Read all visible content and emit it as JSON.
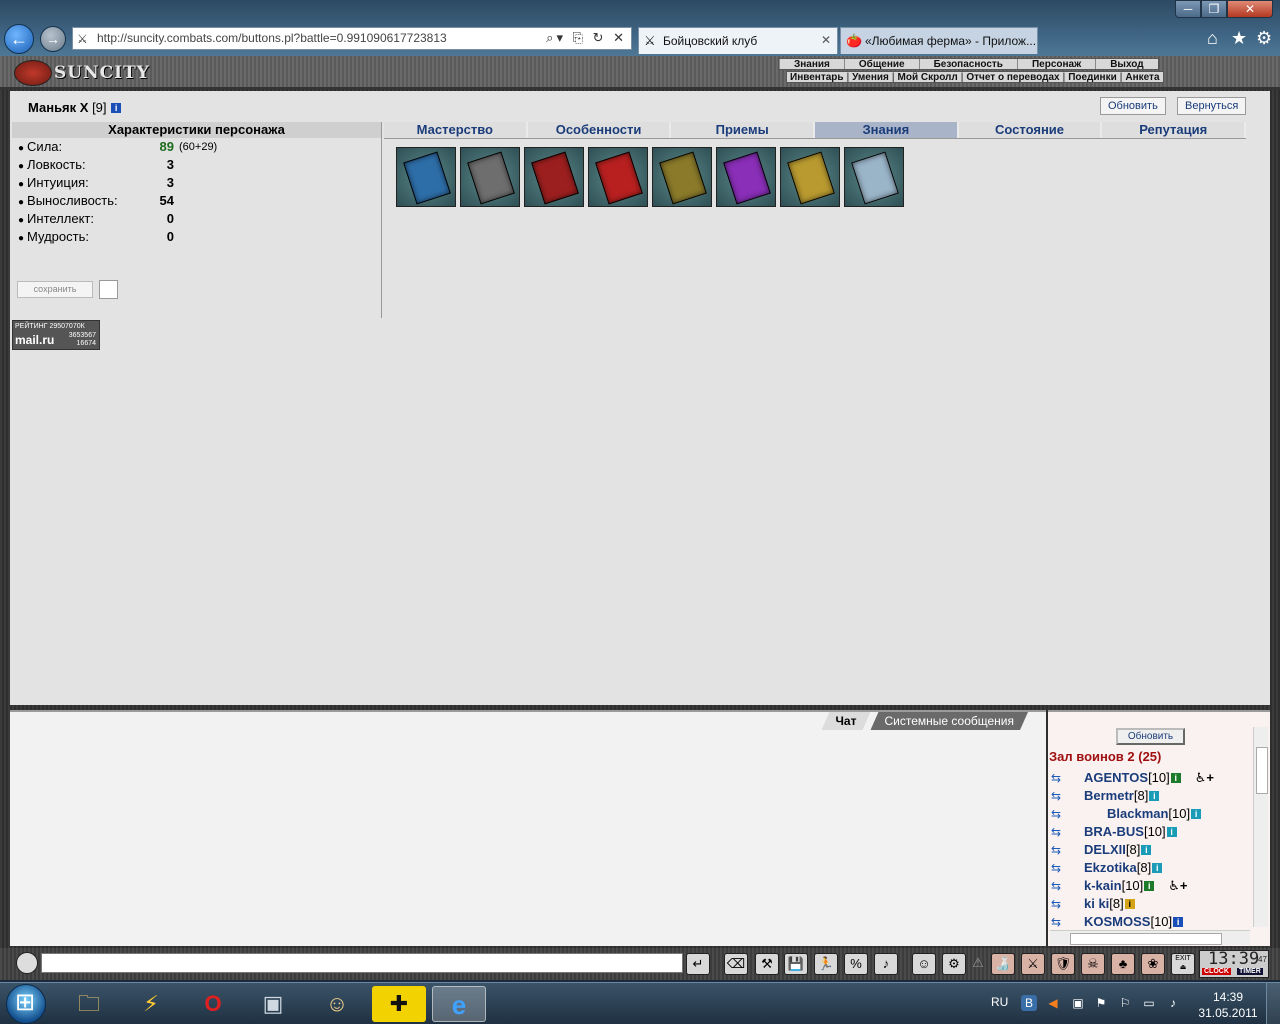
{
  "browser": {
    "url": "http://suncity.combats.com/buttons.pl?battle=0.991090617723813",
    "tabs": [
      {
        "label": "Бойцовский клуб"
      },
      {
        "label": "«Любимая ферма» - Прилож..."
      }
    ],
    "window_controls": {
      "minimize": "─",
      "maximize": "❐",
      "close": "✕"
    }
  },
  "header": {
    "logo": "SUNCITY",
    "menu_top": [
      "Знания",
      "Общение",
      "Безопасность",
      "Персонаж",
      "Выход"
    ],
    "menu_sub": [
      "Инвентарь",
      "Умения",
      "Мой Скролл",
      "Отчет о переводах",
      "Поединки",
      "Анкета"
    ]
  },
  "character": {
    "name": "Маньяк X",
    "level": "[9]",
    "refresh_label": "Обновить",
    "return_label": "Вернуться",
    "panel_title": "Характеристики персонажа",
    "stats": [
      {
        "label": "Сила:",
        "value": "89",
        "extra": "(60+29)",
        "highlight": true
      },
      {
        "label": "Ловкость:",
        "value": "3",
        "extra": ""
      },
      {
        "label": "Интуиция:",
        "value": "3",
        "extra": ""
      },
      {
        "label": "Выносливость:",
        "value": "54",
        "extra": ""
      },
      {
        "label": "Интеллект:",
        "value": "0",
        "extra": ""
      },
      {
        "label": "Мудрость:",
        "value": "0",
        "extra": ""
      }
    ],
    "save_label": "сохранить"
  },
  "rating": {
    "line1": "РЕЙТИНГ 29507070К",
    "brand": "mail.ru",
    "line2": "3653567",
    "line3": "16674"
  },
  "tabs": [
    {
      "label": "Мастерство"
    },
    {
      "label": "Особенности"
    },
    {
      "label": "Приемы"
    },
    {
      "label": "Знания",
      "active": true
    },
    {
      "label": "Состояние"
    },
    {
      "label": "Репутация"
    }
  ],
  "cards": [
    {
      "color": "#2e6ea8"
    },
    {
      "color": "#6e6e6e"
    },
    {
      "color": "#9c1f1f"
    },
    {
      "color": "#b82020"
    },
    {
      "color": "#8a7a2a"
    },
    {
      "color": "#8a2fb8"
    },
    {
      "color": "#b89a30"
    },
    {
      "color": "#9ab4c8"
    }
  ],
  "chat": {
    "tabs": [
      {
        "label": "Чат",
        "active": true
      },
      {
        "label": "Системные сообщения"
      }
    ]
  },
  "online": {
    "refresh_label": "Обновить",
    "room_title": "Зал воинов 2 (25)",
    "players": [
      {
        "name": "AGENTOS",
        "level": "[10]",
        "info": "green",
        "extra": "♿+"
      },
      {
        "name": "Bermetr",
        "level": "[8]",
        "info": "teal",
        "extra": ""
      },
      {
        "name": "Blackman",
        "level": "[10]",
        "info": "teal",
        "extra": ""
      },
      {
        "name": "BRA-BUS",
        "level": "[10]",
        "info": "teal",
        "extra": ""
      },
      {
        "name": "DELXII",
        "level": "[8]",
        "info": "teal",
        "extra": ""
      },
      {
        "name": "Ekzotika",
        "level": "[8]",
        "info": "teal",
        "extra": ""
      },
      {
        "name": "k-kain",
        "level": "[10]",
        "info": "green",
        "extra": "♿+"
      },
      {
        "name": "ki ki",
        "level": "[8]",
        "info": "gold",
        "extra": ""
      },
      {
        "name": "KOSMOSS",
        "level": "[10]",
        "info": "blue",
        "extra": ""
      }
    ]
  },
  "bottombar": {
    "buttons": [
      "↵",
      "⌫",
      "⚒",
      "💾",
      "🏃",
      "%",
      "♪",
      "☺",
      "⚙",
      "⚠",
      "🍶",
      "⚔",
      "🛡",
      "☠",
      "♣",
      "❀",
      "⏏"
    ],
    "clock_time": "13:39",
    "clock_sec": "47",
    "clock_label": "CLOCK",
    "timer_label": "TIMER",
    "exit_label": "EXIT"
  },
  "taskbar": {
    "apps": [
      "🗀",
      "⚡",
      "O",
      "▣",
      "☺",
      "✚",
      "e"
    ],
    "lang": "RU",
    "time": "14:39",
    "date": "31.05.2011"
  }
}
